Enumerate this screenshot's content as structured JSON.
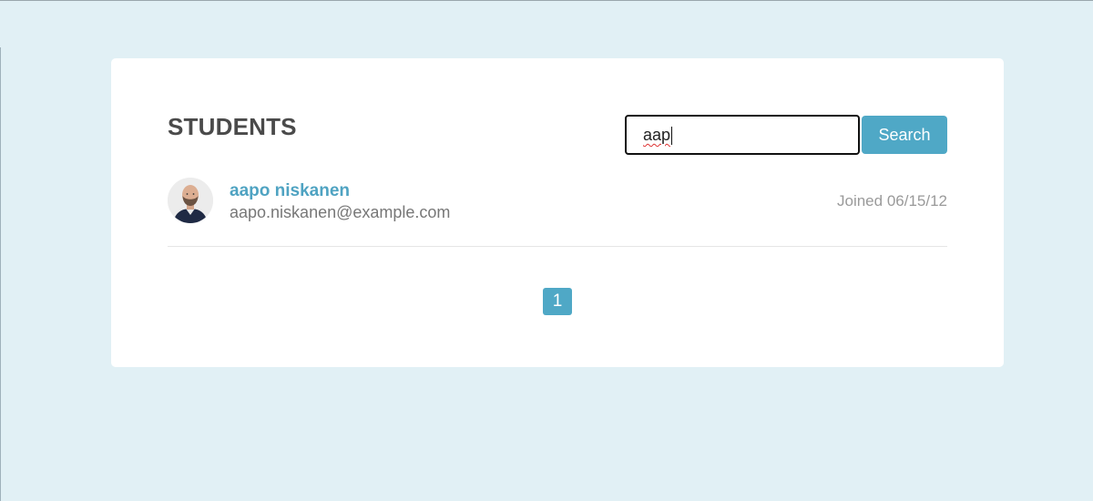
{
  "page": {
    "title": "STUDENTS"
  },
  "search": {
    "value": "aap",
    "button_label": "Search",
    "icon": "search-field"
  },
  "students": [
    {
      "name": "aapo niskanen",
      "email": "aapo.niskanen@example.com",
      "joined": "Joined 06/15/12",
      "avatar_icon": "user-avatar-photo"
    }
  ],
  "pagination": {
    "pages": [
      "1"
    ],
    "current": "1"
  },
  "colors": {
    "background": "#e1f0f5",
    "accent": "#4fa8c6",
    "name_link": "#4fa3c2",
    "title": "#4a4a4a"
  }
}
